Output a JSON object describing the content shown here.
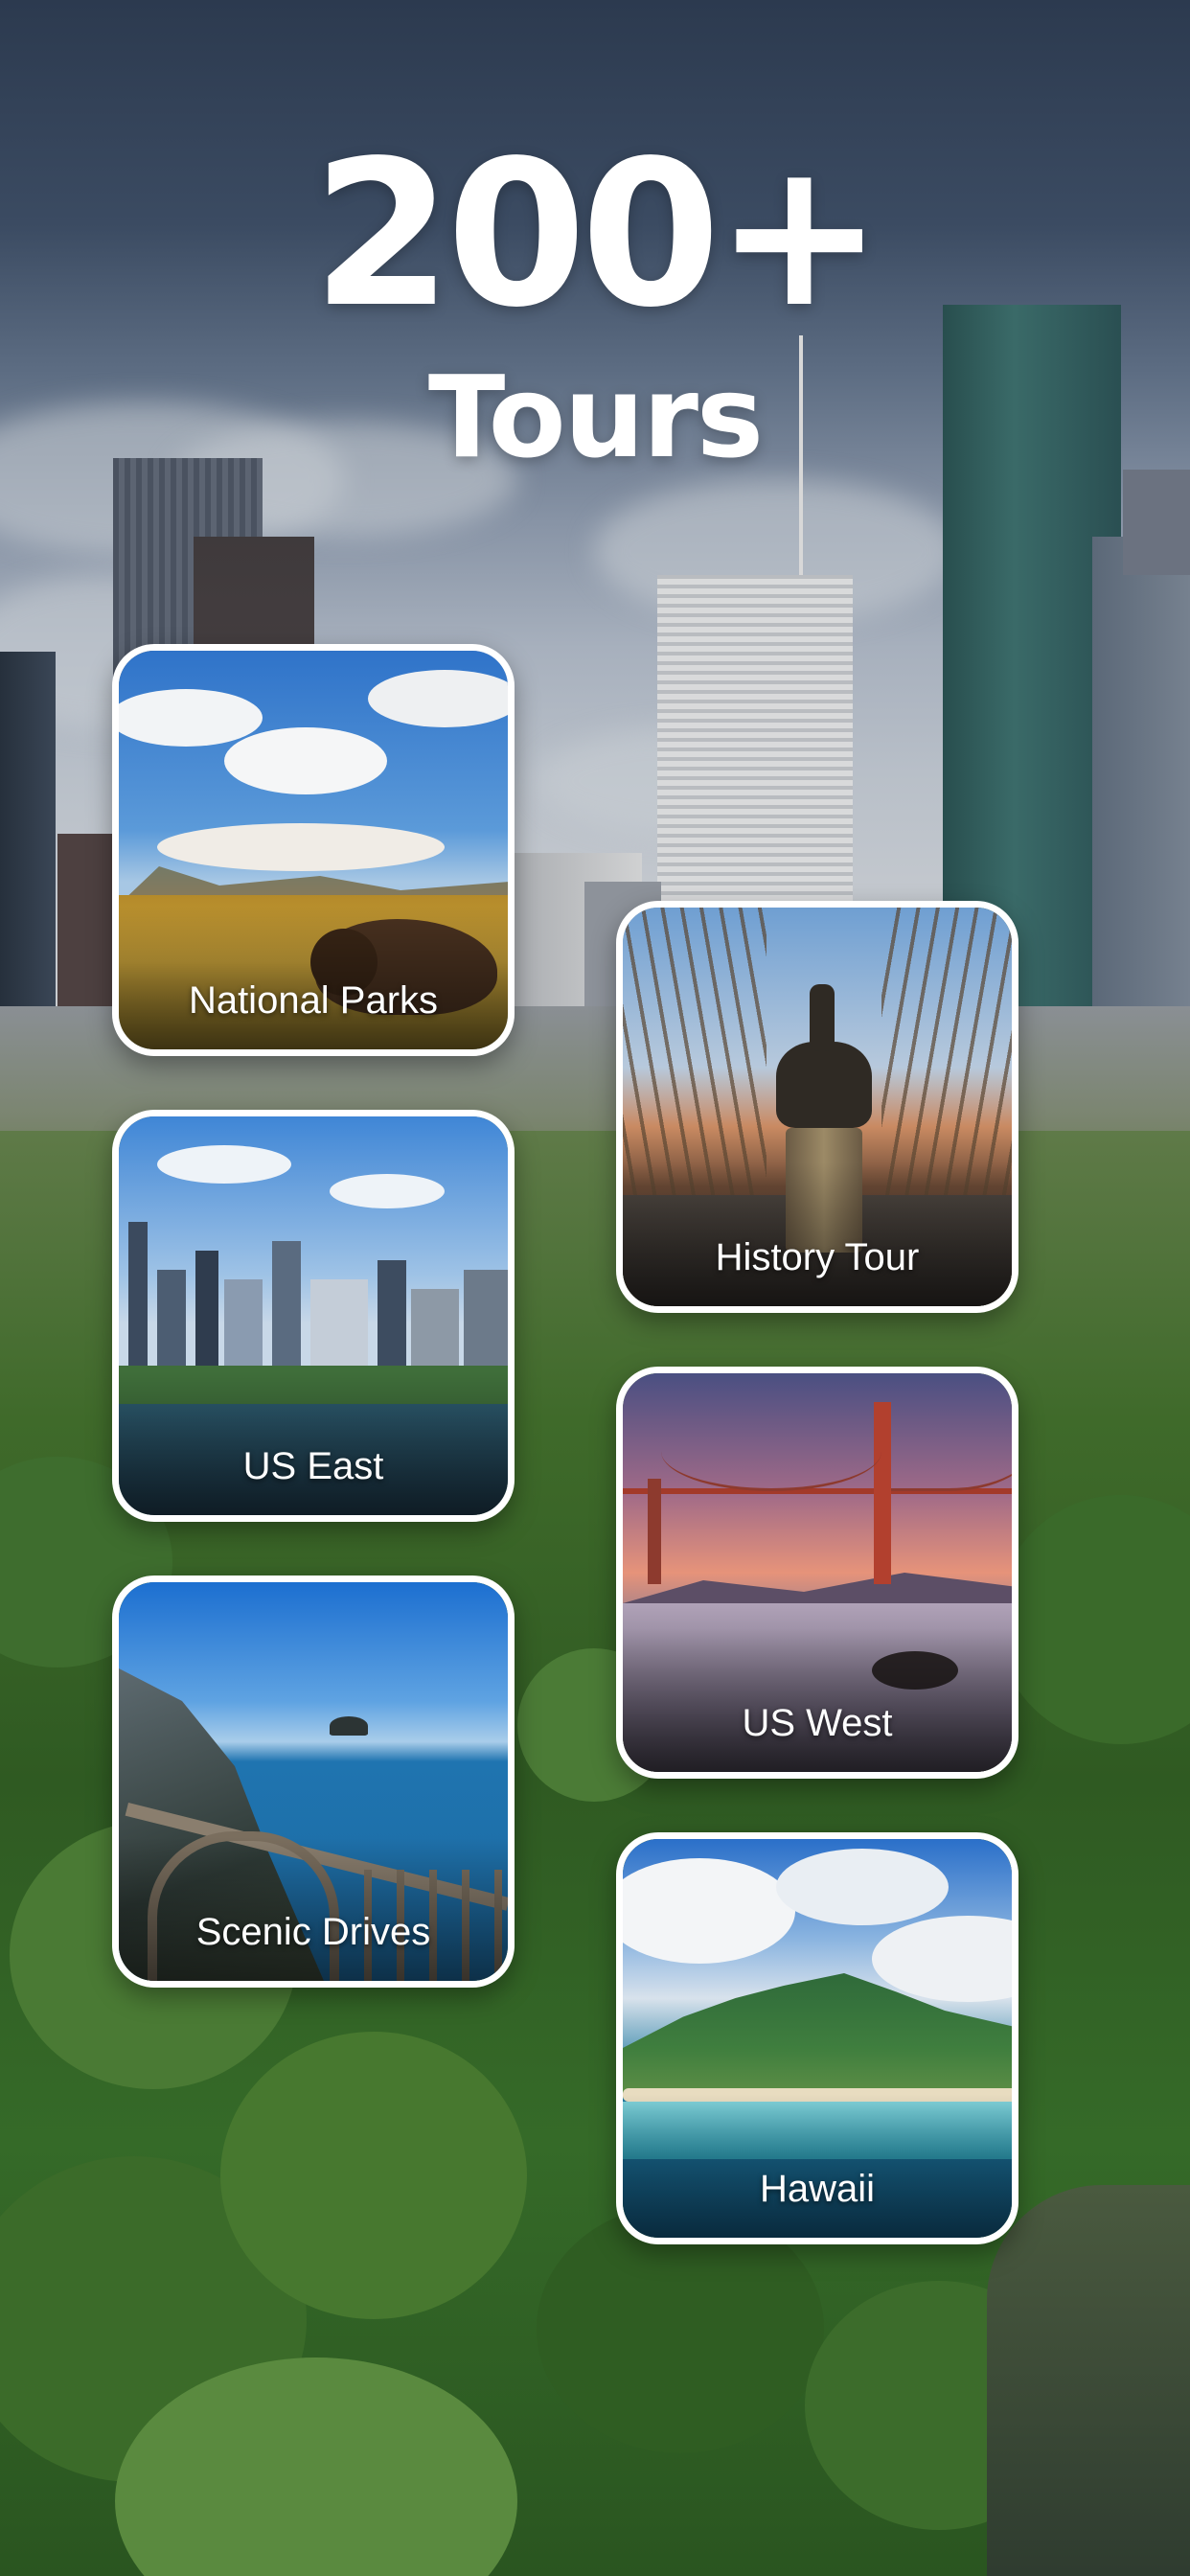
{
  "headline": {
    "count": "200+",
    "subtitle": "Tours"
  },
  "cards": [
    {
      "label": "National Parks",
      "icon": "bison-prairie-image"
    },
    {
      "label": "History Tour",
      "icon": "statue-park-image"
    },
    {
      "label": "US East",
      "icon": "city-skyline-image"
    },
    {
      "label": "US West",
      "icon": "golden-gate-bridge-image"
    },
    {
      "label": "Scenic Drives",
      "icon": "coastal-bridge-image"
    },
    {
      "label": "Hawaii",
      "icon": "island-mountain-image"
    }
  ],
  "colors": {
    "card_border": "#ffffff",
    "headline_text": "#ffffff",
    "sky_top": "#2c3a4f",
    "forest": "#2f5a22"
  }
}
